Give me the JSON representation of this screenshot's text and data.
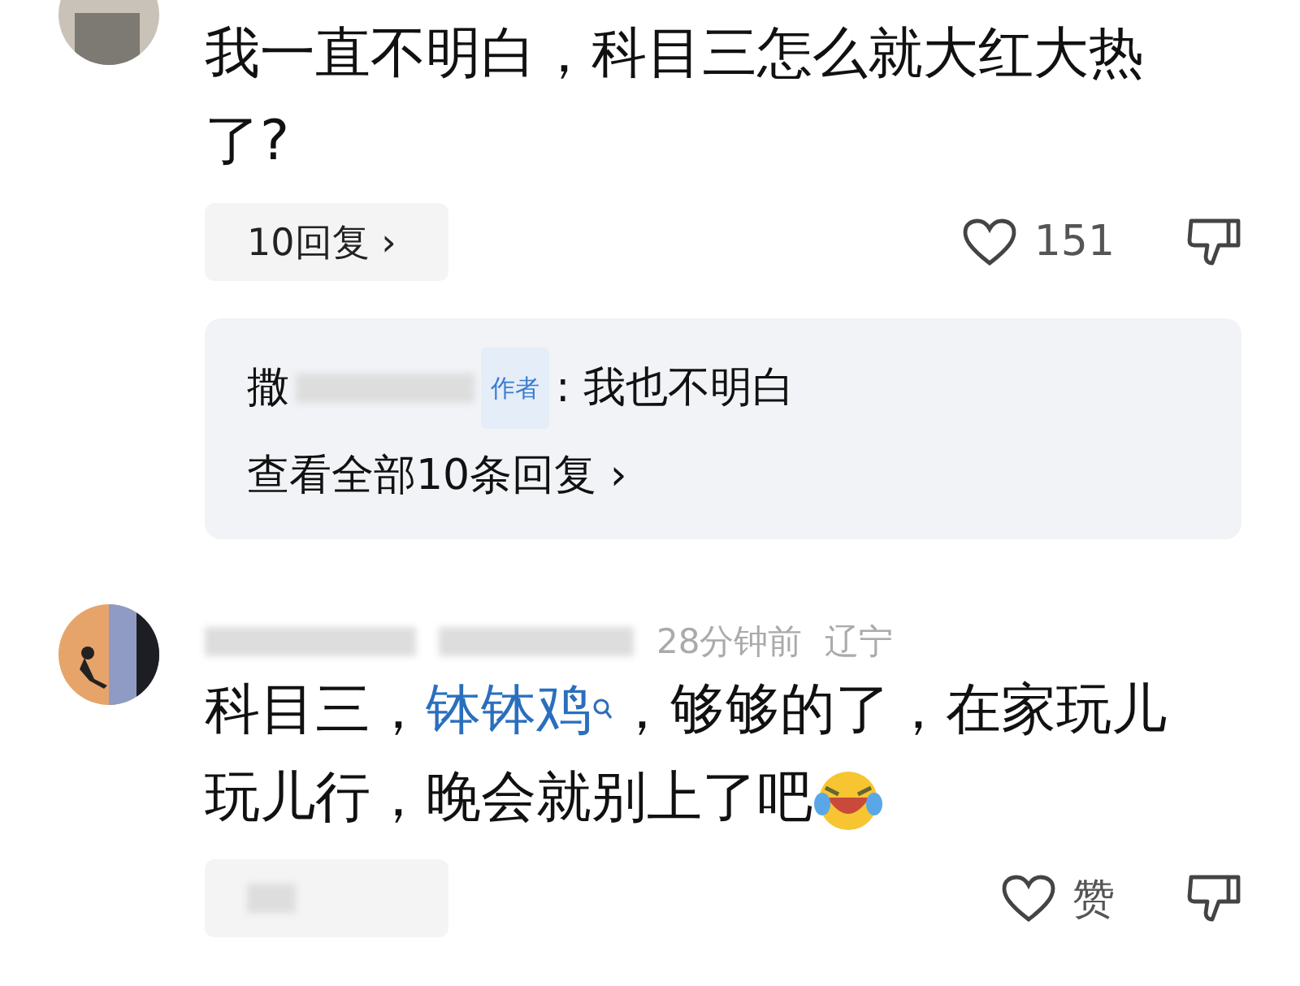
{
  "comments": [
    {
      "segments": [
        {
          "kind": "text",
          "text": "我一直不明白，科目三怎么就大红大热了?"
        }
      ],
      "reply_button": "10回复 ›",
      "likes": "151",
      "thread": {
        "author": "撒",
        "badge": "作者",
        "separator": ":",
        "text": "我也不明白",
        "view_all": "查看全部10条回复 ›"
      }
    },
    {
      "time": "28分钟前",
      "location": "辽宁",
      "segments": [
        {
          "kind": "text",
          "text": "科目三，"
        },
        {
          "kind": "link",
          "text": "钵钵鸡"
        },
        {
          "kind": "text",
          "text": "，够够的了，在家玩儿玩儿行，晚会就别上了吧"
        },
        {
          "kind": "emoji"
        }
      ],
      "likes": "赞"
    }
  ]
}
